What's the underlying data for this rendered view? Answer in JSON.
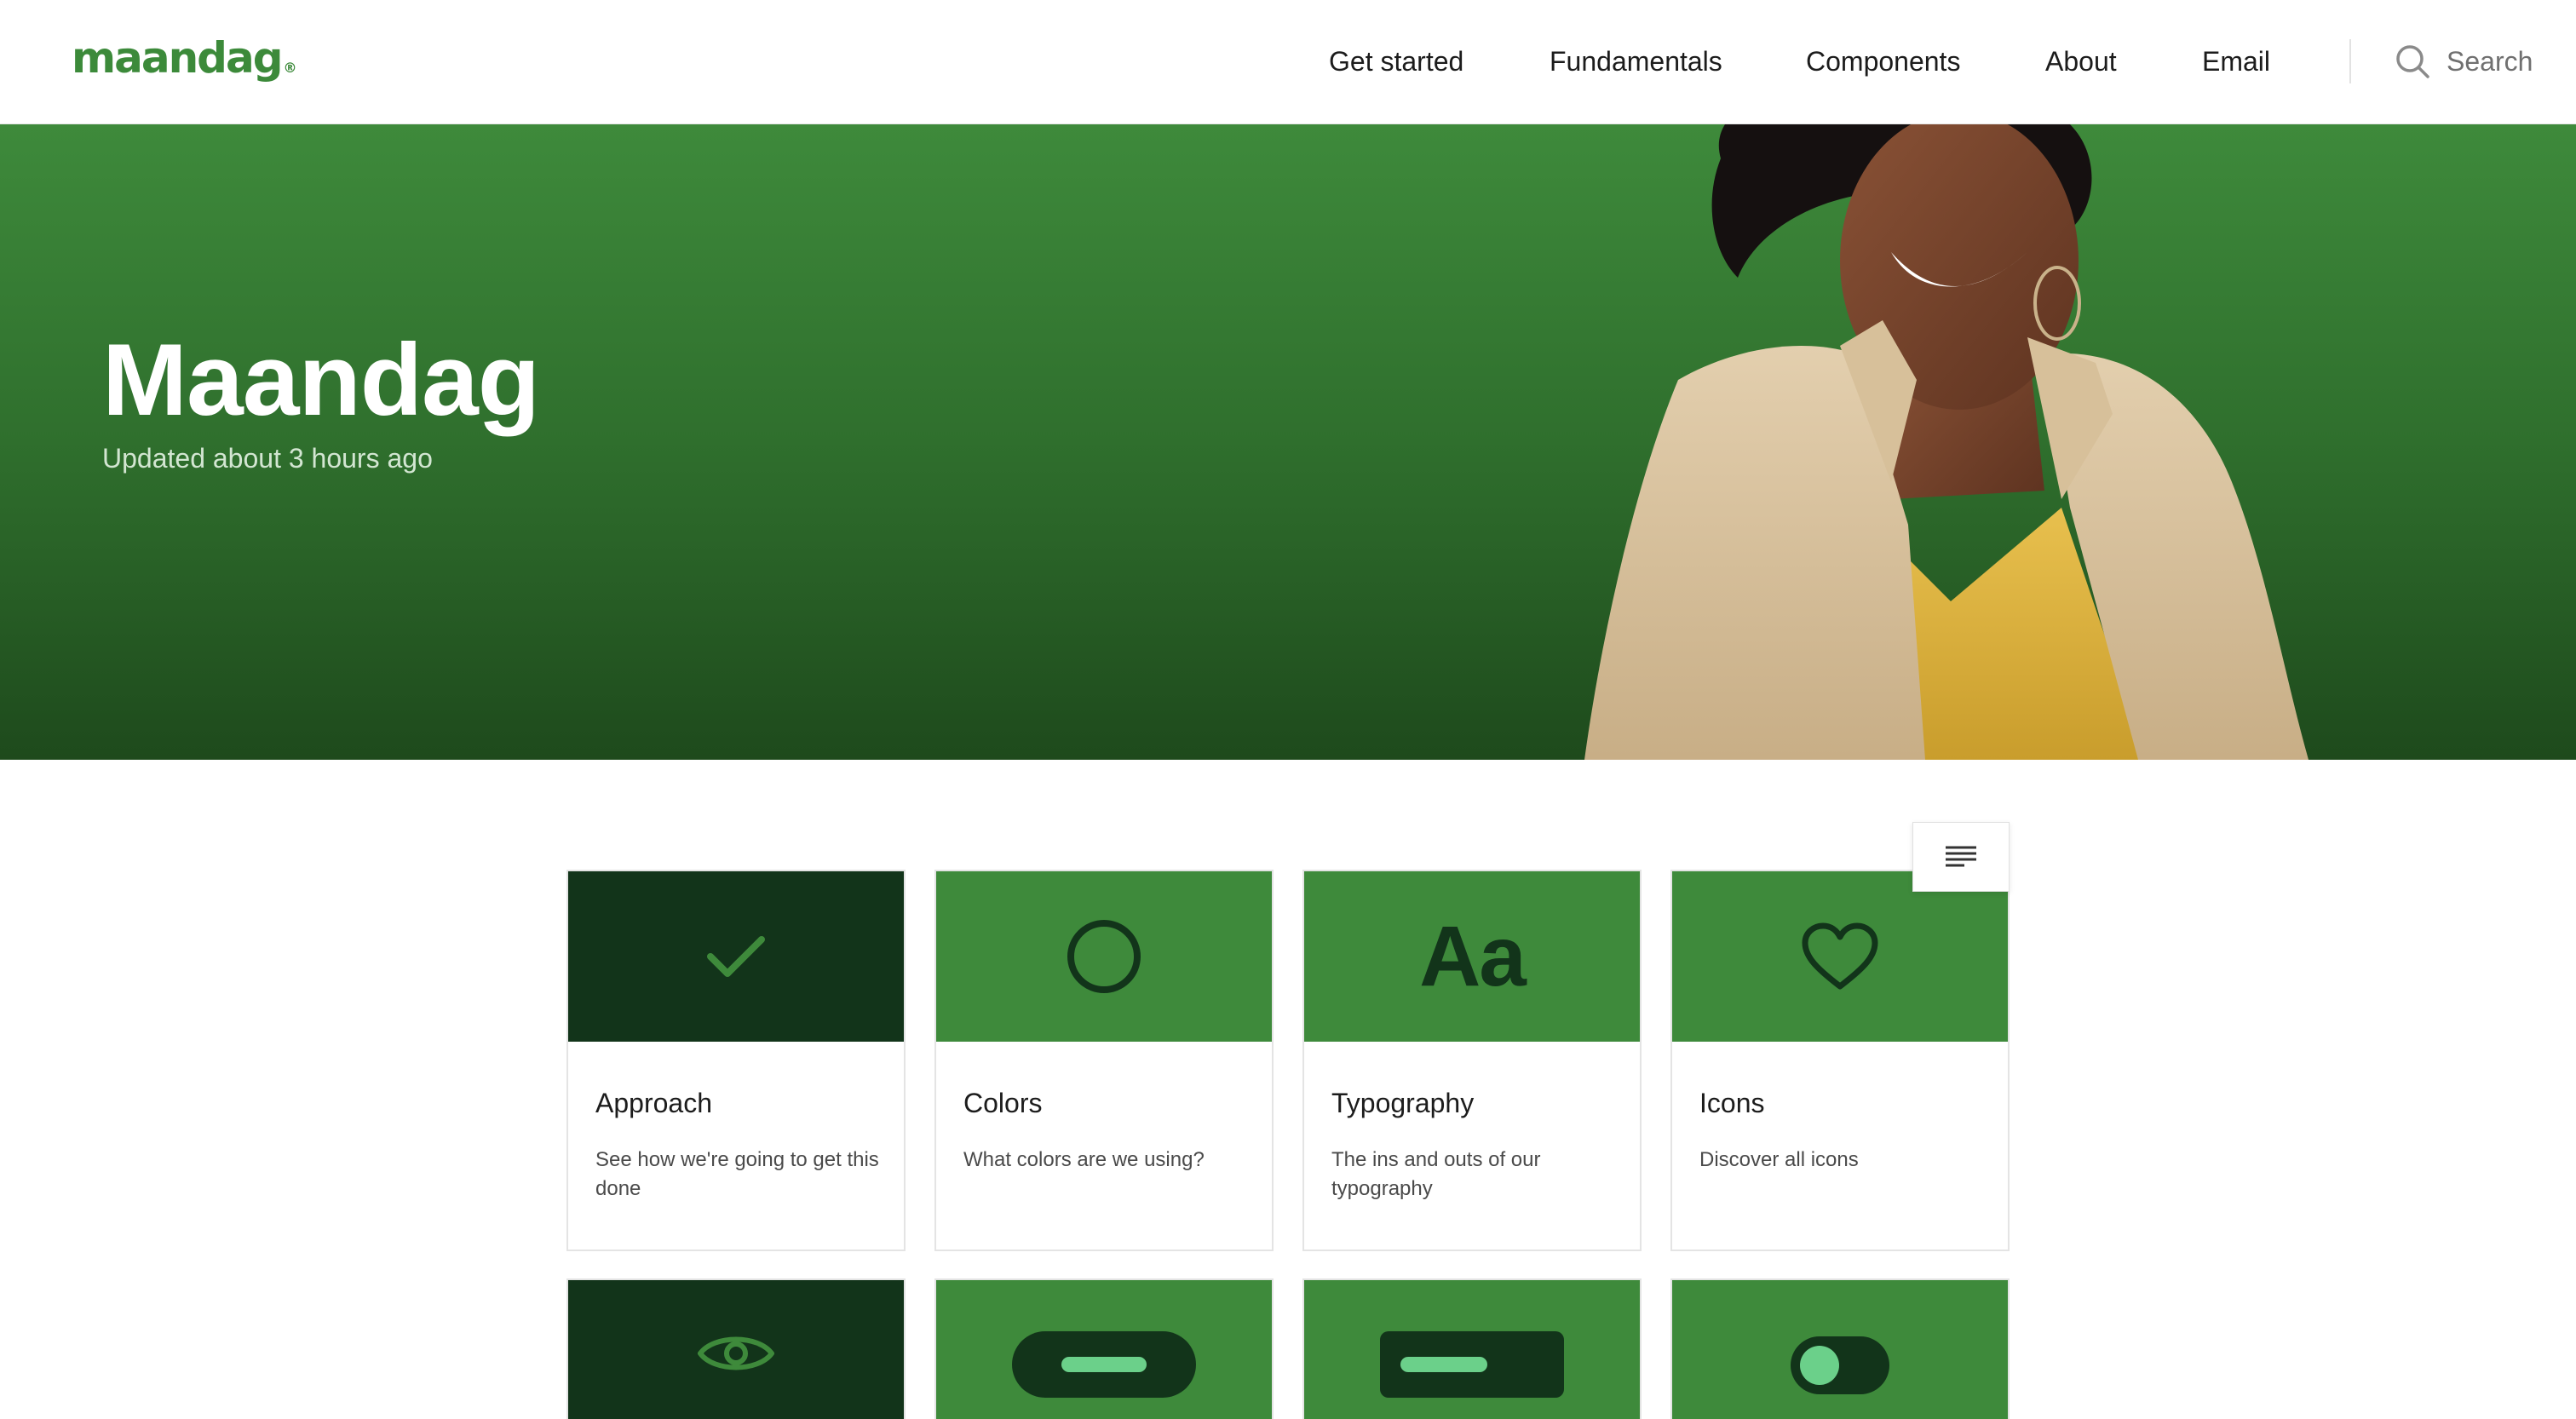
{
  "header": {
    "logo_text": "maandag",
    "logo_mark": "®",
    "nav": [
      {
        "label": "Get started"
      },
      {
        "label": "Fundamentals"
      },
      {
        "label": "Components"
      },
      {
        "label": "About"
      },
      {
        "label": "Email"
      }
    ],
    "search_label": "Search",
    "search_icon": "search-icon"
  },
  "hero": {
    "title": "Maandag",
    "subtitle": "Updated about 3 hours ago",
    "image": "portrait-photo"
  },
  "toc_button": {
    "icon": "align-left-icon"
  },
  "cards": [
    {
      "title": "Approach",
      "description": "See how we're going to get this done",
      "icon": "checkmark-icon"
    },
    {
      "title": "Colors",
      "description": "What colors are we using?",
      "icon": "circle-icon"
    },
    {
      "title": "Typography",
      "description": "The ins and outs of our typography",
      "icon": "typography-icon",
      "glyph": "Aa"
    },
    {
      "title": "Icons",
      "description": "Discover all icons",
      "icon": "heart-icon"
    },
    {
      "icon": "eye-icon"
    },
    {
      "icon": "pill-button-icon"
    },
    {
      "icon": "rect-button-icon"
    },
    {
      "icon": "toggle-icon"
    }
  ],
  "colors": {
    "brand_green": "#3e8a3b",
    "dark_green": "#12341a",
    "accent_light_green": "#6bd08a"
  }
}
